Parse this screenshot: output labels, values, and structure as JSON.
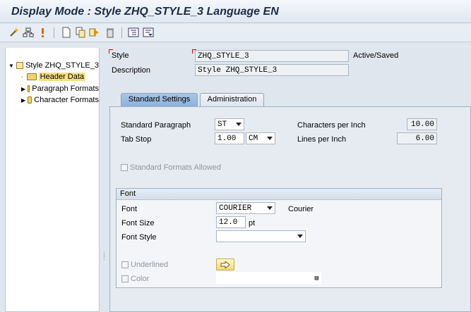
{
  "window": {
    "title": "Display Mode : Style ZHQ_STYLE_3 Language EN"
  },
  "toolbar": {
    "icons": [
      "magic-wand-icon",
      "hierarchy-icon",
      "info-icon",
      "new-page-icon",
      "copy-page-icon",
      "forward-icon",
      "trash-icon",
      "expand-tree-icon",
      "collapse-tree-icon"
    ]
  },
  "tree": {
    "root": "Style ZHQ_STYLE_3",
    "items": [
      {
        "label": "Header Data"
      },
      {
        "label": "Paragraph Formats"
      },
      {
        "label": "Character Formats"
      }
    ]
  },
  "header": {
    "style_label": "Style",
    "style_value": "ZHQ_STYLE_3",
    "status": "Active/Saved",
    "description_label": "Description",
    "description_value": "Style ZHQ_STYLE_3"
  },
  "tabs": [
    {
      "label": "Standard Settings",
      "active": true
    },
    {
      "label": "Administration",
      "active": false
    }
  ],
  "settings": {
    "std_paragraph_label": "Standard Paragraph",
    "std_paragraph_value": "ST",
    "tab_stop_label": "Tab Stop",
    "tab_stop_value": "1.00",
    "tab_stop_unit": "CM",
    "cpi_label": "Characters per Inch",
    "cpi_value": "10.00",
    "lpi_label": "Lines per Inch",
    "lpi_value": "6.00",
    "std_formats_label": "Standard Formats Allowed"
  },
  "font": {
    "group_title": "Font",
    "font_label": "Font",
    "font_value": "COURIER",
    "font_desc": "Courier",
    "size_label": "Font Size",
    "size_value": "12.0",
    "size_unit": "pt",
    "style_label": "Font Style",
    "style_value": "",
    "underlined_label": "Underlined",
    "color_label": "Color",
    "color_value": ""
  },
  "colors": {
    "active_tab": "#9dbde2",
    "selection": "#f6df83",
    "required": "#d40000"
  }
}
